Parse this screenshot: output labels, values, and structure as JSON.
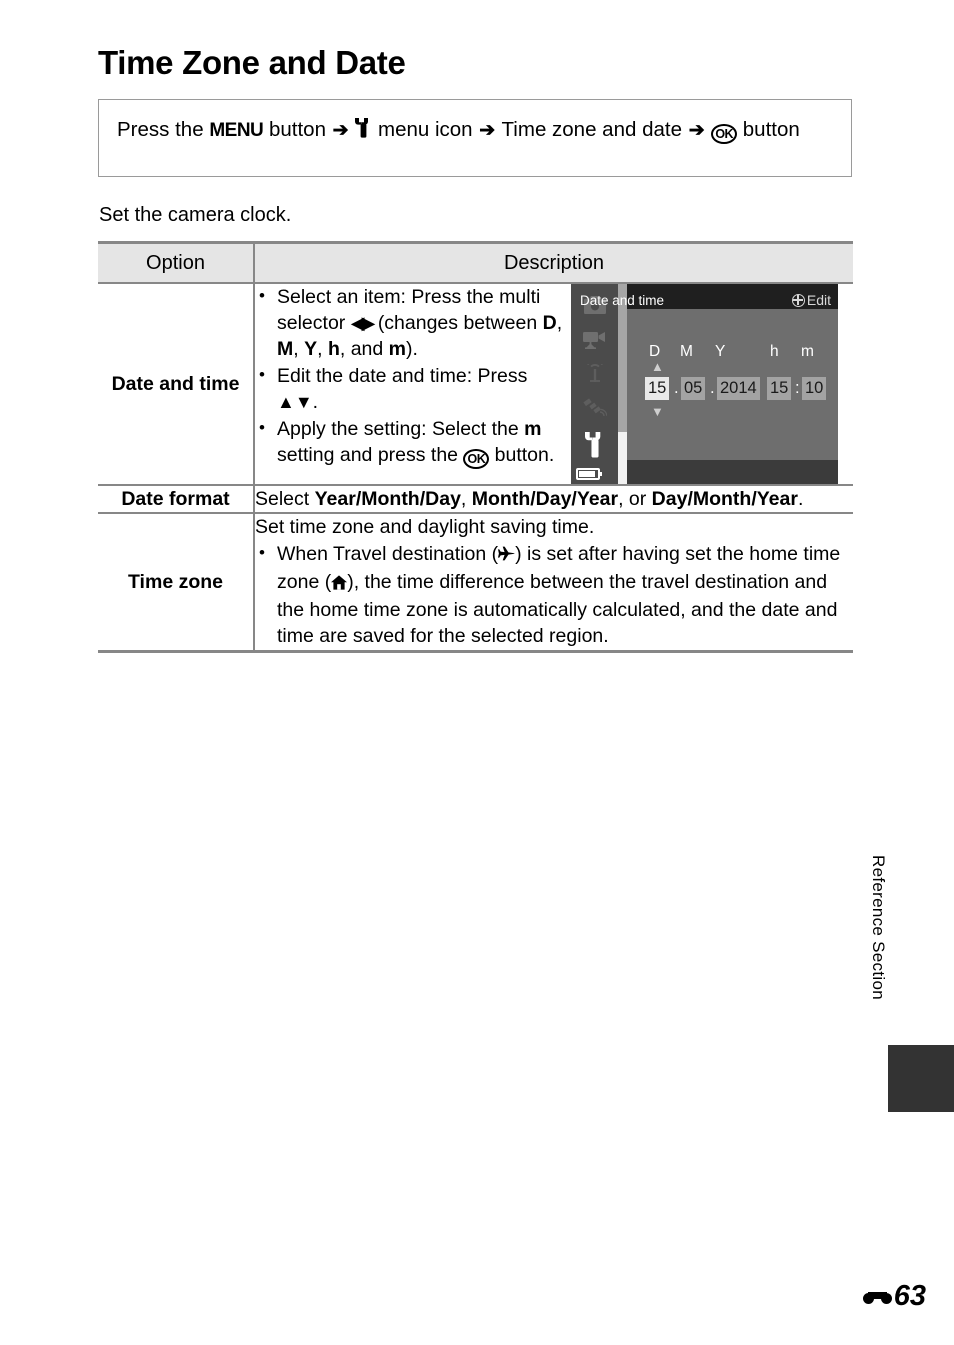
{
  "page": {
    "title": "Time Zone and Date",
    "intro": "Set the camera clock.",
    "page_number": "63",
    "section_label": "Reference Section"
  },
  "path_box": {
    "prefix": "Press the",
    "menu_word": "MENU",
    "after_menu": "button",
    "arrow": "➔",
    "setup_icon": "wrench-icon",
    "menu_icon_label": "menu icon",
    "item_label": "Time zone and date",
    "ok_glyph": "OK",
    "suffix": "button"
  },
  "table": {
    "headers": [
      "Option",
      "Description"
    ],
    "rows": [
      {
        "option": "Date and time",
        "bullets": [
          {
            "pre": "Select an item: Press the multi selector",
            "glyph": "◀▶",
            "mid": "(changes between",
            "keys": [
              "D",
              "M",
              "Y",
              "h",
              "m"
            ],
            "post": ")."
          },
          {
            "pre": "Edit the date and time: Press",
            "glyph": "▲▼",
            "post": "."
          },
          {
            "pre": "Apply the setting: Select the",
            "key": "m",
            "mid": "setting and press the",
            "ok": "OK",
            "post": "button."
          }
        ],
        "screen": {
          "title": "Date and time",
          "field_labels": [
            "D",
            "M",
            "Y",
            "h",
            "m"
          ],
          "values": {
            "day": "15",
            "month": "05",
            "year": "2014",
            "hour": "15",
            "minute": "10"
          },
          "separators": {
            "date_sep": ".",
            "time_sep": ":"
          },
          "selected_field": "day",
          "up_arrow": "▲",
          "down_arrow": "▼",
          "footer_label": "Edit",
          "footer_icon": "globe-icon",
          "sidebar_icons": [
            "camera-icon",
            "movie-icon",
            "wifi-icon",
            "gps-icon",
            "setup-wrench-icon"
          ],
          "battery_icon": "battery-icon"
        }
      },
      {
        "option": "Date format",
        "text_parts": {
          "lead": "Select",
          "opt1": "Year/Month/Day",
          "sep1": ",",
          "opt2": "Month/Day/Year",
          "sep2": ", or",
          "opt3": "Day/Month/Year",
          "end": "."
        }
      },
      {
        "option": "Time zone",
        "lead": "Set time zone and daylight saving time.",
        "bullet": {
          "p1": "When Travel destination (",
          "travel_icon": "airplane-icon",
          "p2": ") is set after having set the home time zone (",
          "home_icon": "house-icon",
          "p3": "), the time difference between the travel destination and the home time zone is automatically calculated, and the date and time are saved for the selected region."
        }
      }
    ]
  }
}
